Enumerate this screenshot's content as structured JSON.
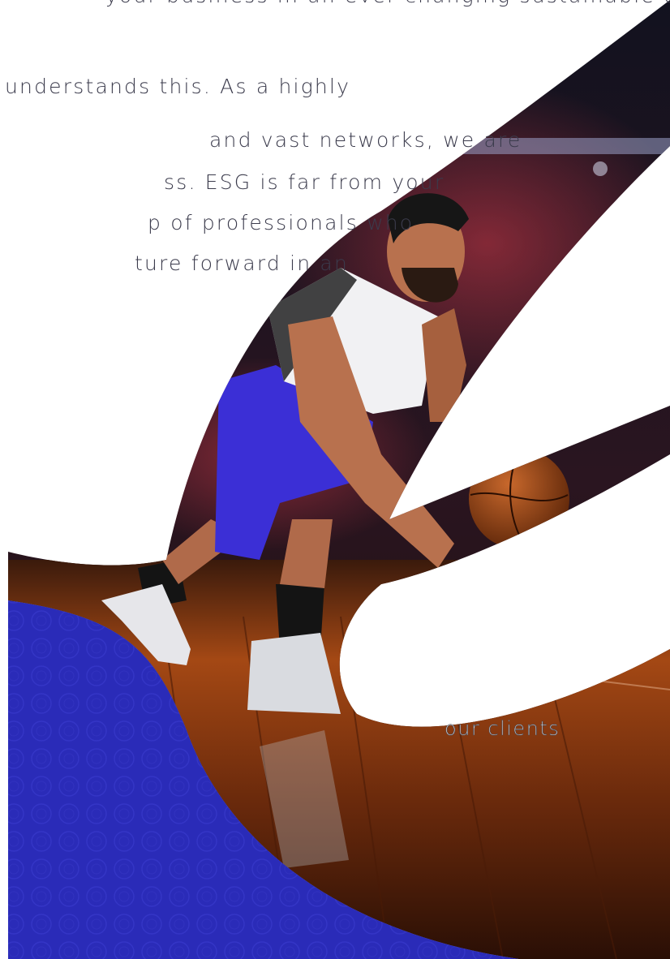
{
  "paragraph": {
    "line_0": "your business in an ever-changing sustainable ecosystem",
    "line_1": "understands this. As a highly",
    "line_2": "and vast networks, we are",
    "line_3": "ss. ESG is far from your",
    "line_4": "p of professionals who",
    "line_5": "ture forward in an"
  },
  "photo": {
    "subject": "basketball player dribbling on an arena court",
    "shorts_color": "#3b2fd6",
    "floor_color": "#8a3a12"
  },
  "caption": {
    "label": "our clients"
  },
  "colors": {
    "page_background": "#ffffff",
    "brand_blue": "#2a2bb8",
    "text": "#3b3b4c"
  }
}
